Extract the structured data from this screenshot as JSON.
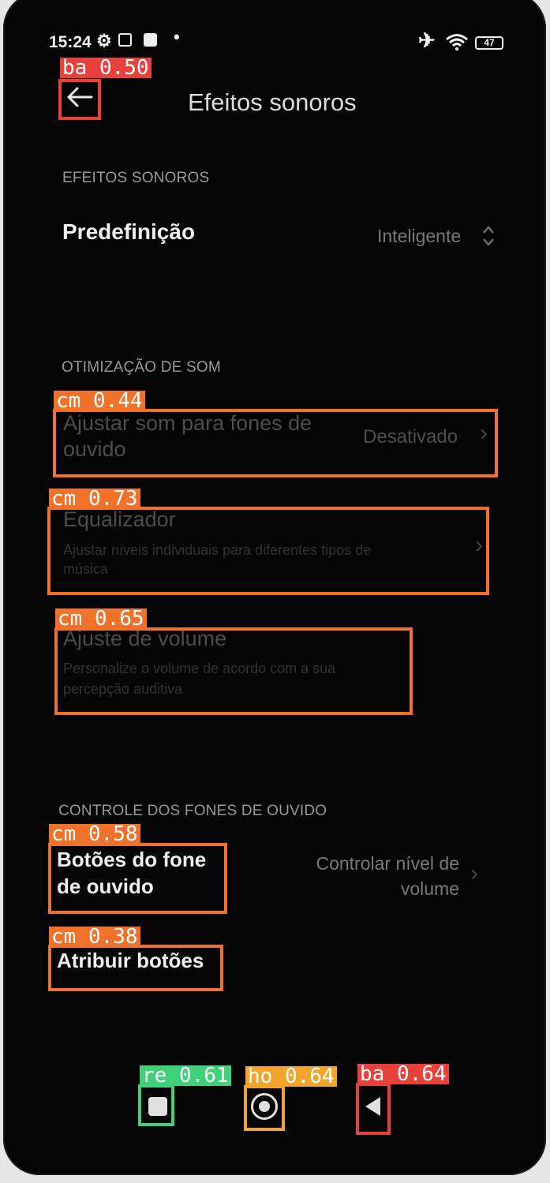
{
  "status_bar": {
    "time": "15:24",
    "dot": "•",
    "battery": "47",
    "icons": [
      "settings-icon",
      "app-icon",
      "news-icon",
      "airplane-icon",
      "wifi-icon",
      "battery-icon"
    ]
  },
  "header": {
    "title": "Efeitos sonoros",
    "back_icon": "back-arrow-icon"
  },
  "sections": {
    "effects": {
      "heading": "EFEITOS SONOROS",
      "preset_label": "Predefinição",
      "preset_value": "Inteligente"
    },
    "optimization": {
      "heading": "OTIMIZAÇÃO DE SOM",
      "headphones_label_1": "Ajustar som para fones de",
      "headphones_label_2": "ouvido",
      "headphones_value": "Desativado",
      "equalizer_title": "Equalizador",
      "equalizer_desc_1": "Ajustar níveis individuais para diferentes tipos de",
      "equalizer_desc_2": "música",
      "volume_title": "Ajuste de volume",
      "volume_desc_1": "Personalize o volume de acordo com a sua",
      "volume_desc_2": "percepção auditiva"
    },
    "headphone_control": {
      "heading": "CONTROLE DOS FONES DE OUVIDO",
      "buttons_label_1": "Botões do fone",
      "buttons_label_2": "de ouvido",
      "buttons_value_1": "Controlar nível de",
      "buttons_value_2": "volume",
      "assign_label": "Atribuir botões"
    }
  },
  "detections": {
    "back_top": "ba 0.50",
    "headphones": "cm 0.44",
    "equalizer": "cm 0.73",
    "volume": "cm 0.65",
    "buttons": "cm 0.58",
    "assign": "cm 0.38",
    "recents": "re 0.61",
    "home": "ho 0.64",
    "back_nav": "ba 0.64",
    "colors": {
      "cm": "#f0722a",
      "ba": "#e8403a",
      "re": "#3fd07a",
      "ho": "#f2a52a"
    }
  },
  "nav_bar": {
    "recents_icon": "recents-square-icon",
    "home_icon": "home-circle-icon",
    "back_icon": "back-triangle-icon"
  }
}
